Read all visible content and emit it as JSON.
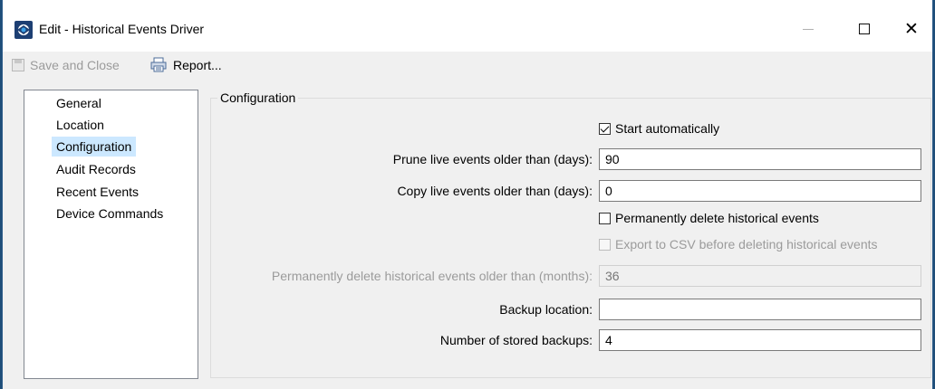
{
  "window": {
    "title": "Edit - Historical Events Driver",
    "minimize_glyph": "—",
    "maximize_glyph": "☐",
    "close_glyph": "✕"
  },
  "toolbar": {
    "save_label": "Save and Close",
    "report_label": "Report..."
  },
  "nav": {
    "items": [
      "General",
      "Location",
      "Configuration",
      "Audit Records",
      "Recent Events",
      "Device Commands"
    ],
    "selected": "Configuration"
  },
  "config": {
    "group_title": "Configuration",
    "start_auto_label": "Start automatically",
    "start_auto_checked": true,
    "prune_label": "Prune live events older than (days):",
    "prune_value": "90",
    "copy_label": "Copy live events older than (days):",
    "copy_value": "0",
    "perm_delete_label": "Permanently delete historical events",
    "perm_delete_checked": false,
    "export_label": "Export to CSV before deleting historical events",
    "export_checked": false,
    "perm_months_label": "Permanently delete historical events older than (months):",
    "perm_months_value": "36",
    "backup_label": "Backup location:",
    "backup_value": "",
    "num_backups_label": "Number of stored backups:",
    "num_backups_value": "4"
  },
  "colors": {
    "selected_bg": "#cce8ff",
    "app_icon": "#1d3f73"
  }
}
